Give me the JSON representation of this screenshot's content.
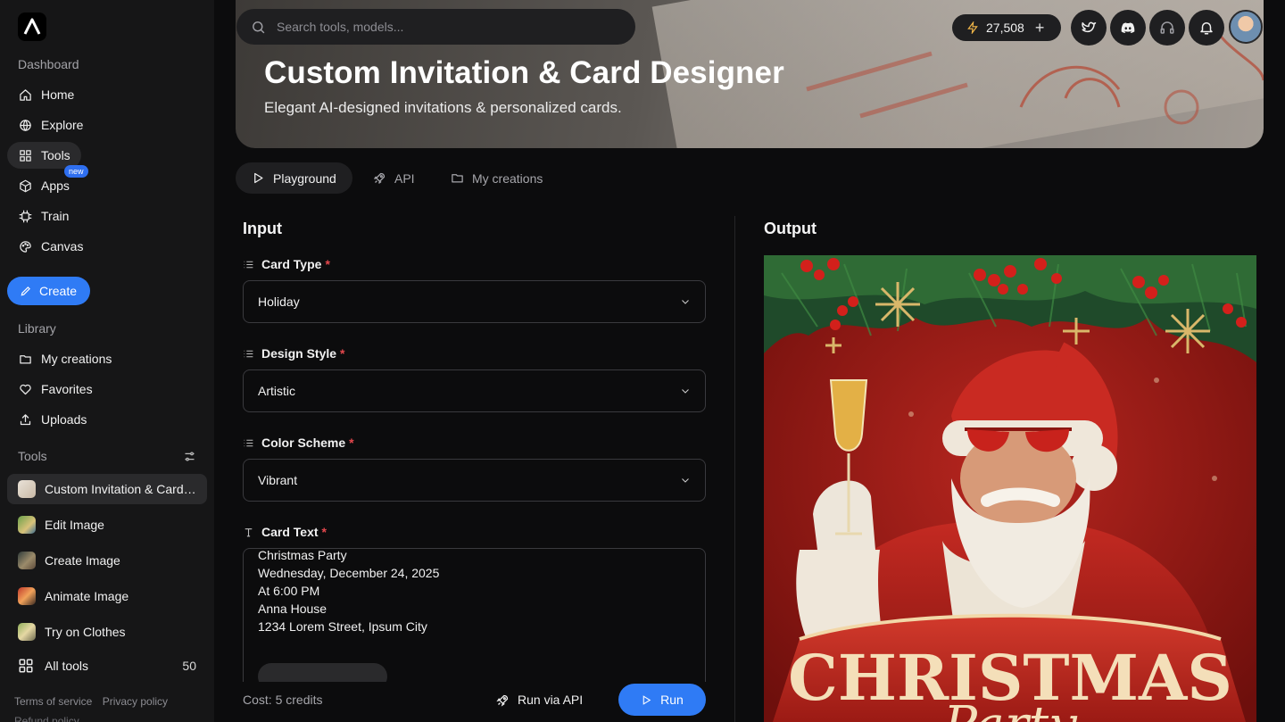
{
  "sidebar": {
    "dashboard_heading": "Dashboard",
    "nav": [
      {
        "label": "Home",
        "icon": "home-icon"
      },
      {
        "label": "Explore",
        "icon": "globe-icon"
      },
      {
        "label": "Tools",
        "icon": "grid-icon",
        "active": true
      },
      {
        "label": "Apps",
        "icon": "box-icon",
        "badge": "new"
      },
      {
        "label": "Train",
        "icon": "chip-icon"
      },
      {
        "label": "Canvas",
        "icon": "palette-icon"
      }
    ],
    "create_label": "Create",
    "library_heading": "Library",
    "library": [
      {
        "label": "My creations",
        "icon": "folder-icon"
      },
      {
        "label": "Favorites",
        "icon": "heart-icon"
      },
      {
        "label": "Uploads",
        "icon": "upload-icon"
      }
    ],
    "tools_heading": "Tools",
    "tools": [
      {
        "label": "Custom Invitation & Card Designer",
        "active": true
      },
      {
        "label": "Edit Image"
      },
      {
        "label": "Create Image"
      },
      {
        "label": "Animate Image"
      },
      {
        "label": "Try on Clothes"
      }
    ],
    "all_tools_label": "All tools",
    "all_tools_count": "50",
    "footer": {
      "terms": "Terms of service",
      "privacy": "Privacy policy",
      "refund": "Refund policy"
    }
  },
  "topbar": {
    "search_placeholder": "Search tools, models...",
    "credits": "27,508",
    "credits_plus": "+"
  },
  "hero": {
    "title": "Custom Invitation & Card Designer",
    "subtitle": "Elegant AI-designed invitations & personalized cards."
  },
  "tabs": [
    {
      "label": "Playground",
      "icon": "play-icon",
      "active": true
    },
    {
      "label": "API",
      "icon": "rocket-icon"
    },
    {
      "label": "My creations",
      "icon": "folder-icon"
    }
  ],
  "input": {
    "title": "Input",
    "card_type": {
      "label": "Card Type",
      "required": "*",
      "value": "Holiday"
    },
    "design_style": {
      "label": "Design Style",
      "required": "*",
      "value": "Artistic"
    },
    "color_scheme": {
      "label": "Color Scheme",
      "required": "*",
      "value": "Vibrant"
    },
    "card_text": {
      "label": "Card Text",
      "required": "*",
      "lines": [
        "Christmas Party",
        "Wednesday, December 24, 2025",
        "At 6:00 PM",
        "Anna House",
        "1234 Lorem Street, Ipsum City"
      ]
    },
    "cost": "Cost: 5 credits",
    "run_api_label": "Run via API",
    "run_label": "Run"
  },
  "output": {
    "title": "Output",
    "image_text": "CHRISTMAS",
    "image_text_2": "Party"
  },
  "colors": {
    "accent": "#2f7bf5",
    "required": "#e5484d",
    "background": "#0c0c0d",
    "sidebar": "#161617"
  }
}
